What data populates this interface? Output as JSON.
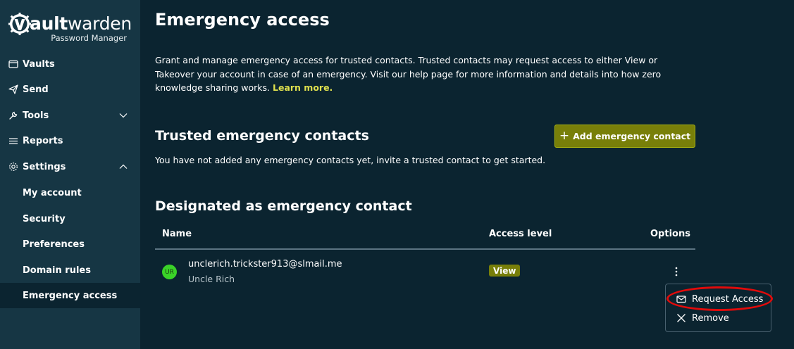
{
  "brand": {
    "name_prefix": "V",
    "name_bold": "ault",
    "name_rest": "warden",
    "subtitle": "Password Manager"
  },
  "sidebar": {
    "items": [
      {
        "label": "Vaults",
        "icon": "vault-icon"
      },
      {
        "label": "Send",
        "icon": "send-icon"
      },
      {
        "label": "Tools",
        "icon": "wrench-icon",
        "chevron": "chevron-down-icon"
      },
      {
        "label": "Reports",
        "icon": "reports-icon"
      },
      {
        "label": "Settings",
        "icon": "gear-icon",
        "chevron": "chevron-up-icon"
      }
    ],
    "subitems": [
      {
        "label": "My account"
      },
      {
        "label": "Security"
      },
      {
        "label": "Preferences"
      },
      {
        "label": "Domain rules"
      },
      {
        "label": "Emergency access",
        "active": true
      }
    ]
  },
  "main": {
    "title": "Emergency access",
    "intro_line1": "Grant and manage emergency access for trusted contacts. Trusted contacts may request access to either View or",
    "intro_line2": "Takeover your account in case of an emergency. Visit our help page for more information and details into how zero",
    "intro_line3": "knowledge sharing works.",
    "learn_more": "Learn more.",
    "trusted_heading": "Trusted emergency contacts",
    "add_button": "Add emergency contact",
    "trusted_empty": "You have not added any emergency contacts yet, invite a trusted contact to get started.",
    "designated_heading": "Designated as emergency contact",
    "table": {
      "columns": [
        "Name",
        "Access level",
        "Options"
      ],
      "rows": [
        {
          "avatar": "UR",
          "email": "unclerich.trickster913@slmail.me",
          "name": "Uncle Rich",
          "access": "View"
        }
      ]
    },
    "options_menu": {
      "items": [
        {
          "label": "Request Access",
          "icon": "envelope-icon"
        },
        {
          "label": "Remove",
          "icon": "close-icon"
        }
      ]
    }
  },
  "colors": {
    "background": "#0b2430",
    "sidebar": "#163644",
    "accent": "#787f09",
    "link": "#dfe04e",
    "avatar": "#3ad228",
    "highlight": "#e10b0b"
  }
}
